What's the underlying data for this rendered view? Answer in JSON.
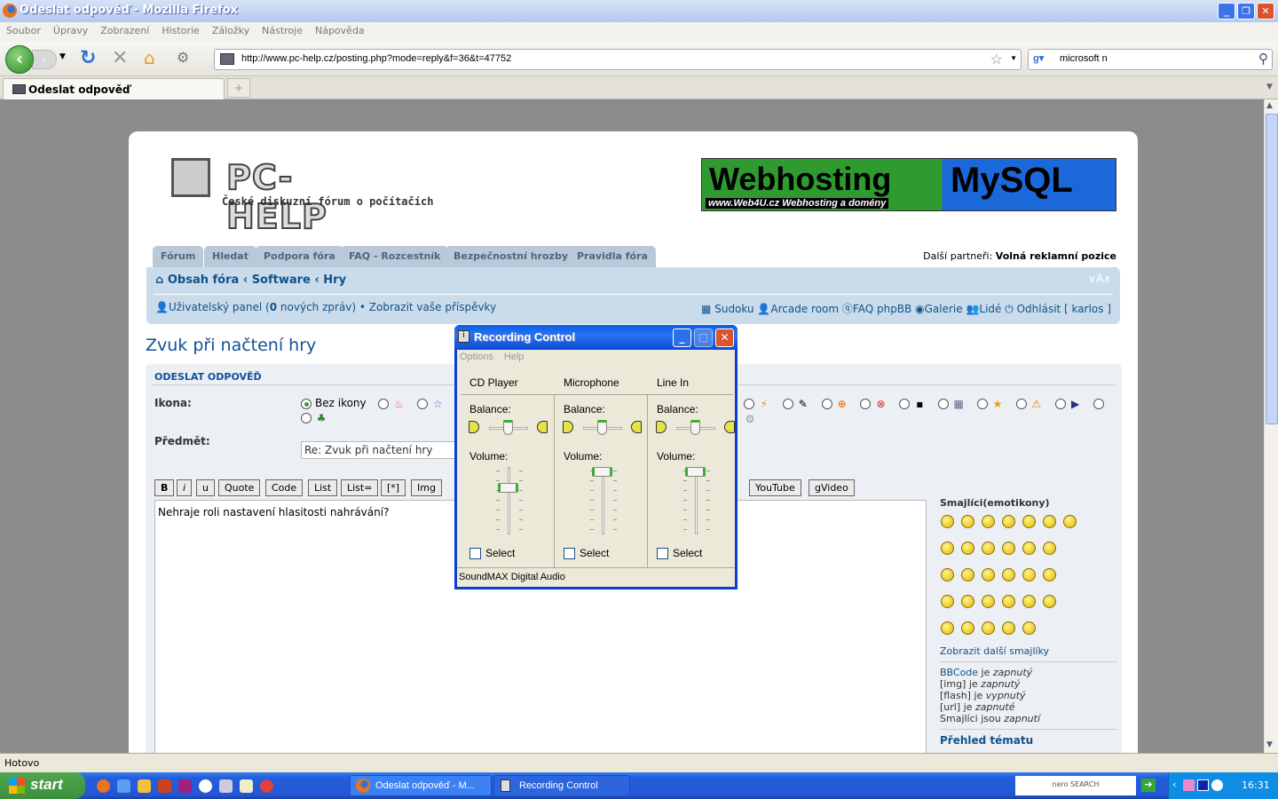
{
  "window": {
    "title": "Odeslat odpověď - Mozilla Firefox"
  },
  "menu": [
    "Soubor",
    "Úpravy",
    "Zobrazení",
    "Historie",
    "Záložky",
    "Nástroje",
    "Nápověda"
  ],
  "url": "http://www.pc-help.cz/posting.php?mode=reply&f=36&t=47752",
  "search": "microsoft n",
  "tab": {
    "label": "Odeslat odpověď"
  },
  "site": {
    "brand": "PC-HELP",
    "tagline": "České diskuzní fórum o počítačích",
    "banner": {
      "left": "Webhosting",
      "right": "MySQL",
      "sub": "www.Web4U.cz  Webhosting a domény"
    },
    "partners_label": "Další partneři:",
    "partners_value": "Volná reklamní pozice",
    "nav_tabs": [
      "Fórum",
      "Hledat",
      "Podpora fóra",
      "FAQ - Rozcestník",
      "Bezpečnostní hrozby",
      "Pravidla fóra"
    ],
    "breadcrumb": [
      "Obsah fóra",
      "Software",
      "Hry"
    ],
    "font_size": "∨A∧",
    "user_panel": "Uživatelský panel",
    "new_msgs_count": "0",
    "new_msgs_text": "nových zpráv",
    "show_posts": "Zobrazit vaše příspěvky",
    "right_links": [
      "Sudoku",
      "Arcade room",
      "FAQ phpBB",
      "Galerie",
      "Lidé",
      "Odhlásit [ karlos ]"
    ]
  },
  "post": {
    "topic_title": "Zvuk při načtení hry",
    "section": "ODESLAT ODPOVĚĎ",
    "icon_label": "Ikona:",
    "no_icon": "Bez ikony",
    "subject_label": "Předmět:",
    "subject": "Re: Zvuk při načtení hry",
    "bbcode_buttons": [
      "B",
      "i",
      "u",
      "Quote",
      "Code",
      "List",
      "List=",
      "[*]",
      "Img"
    ],
    "bbcode_buttons_right": [
      "YouTube",
      "gVideo"
    ],
    "message": "Nehraje roli nastavení hlasitosti nahrávání?",
    "smilies_title": "Smajlíci(emotikony)",
    "more_smilies": "Zobrazit další smajlíky",
    "status": [
      {
        "a": "BBCode",
        "b": " je ",
        "c": "zapnutý"
      },
      {
        "a": "[img]",
        "b": " je ",
        "c": "zapnutý"
      },
      {
        "a": "[flash]",
        "b": " je ",
        "c": "vypnutý"
      },
      {
        "a": "[url]",
        "b": " je ",
        "c": "zapnuté"
      },
      {
        "a": "Smajlíci",
        "b": " jsou ",
        "c": "zapnutí"
      }
    ],
    "topic_review": "Přehled tématu"
  },
  "dialog": {
    "title": "Recording Control",
    "menu": [
      "Options",
      "Help"
    ],
    "columns": [
      {
        "name": "CD Player",
        "balance_label": "Balance:",
        "volume_label": "Volume:",
        "select": "Select",
        "balance": 0.5,
        "volume": 0.75
      },
      {
        "name": "Microphone",
        "balance_label": "Balance:",
        "volume_label": "Volume:",
        "select": "Select",
        "balance": 0.5,
        "volume": 1.0
      },
      {
        "name": "Line In",
        "balance_label": "Balance:",
        "volume_label": "Volume:",
        "select": "Select",
        "balance": 0.5,
        "volume": 1.0
      }
    ],
    "device": "SoundMAX Digital Audio"
  },
  "status_bar": "Hotovo",
  "taskbar": {
    "start": "start",
    "tasks": [
      "Odeslat odpověď - M...",
      "Recording Control"
    ],
    "clock": "16:31"
  }
}
